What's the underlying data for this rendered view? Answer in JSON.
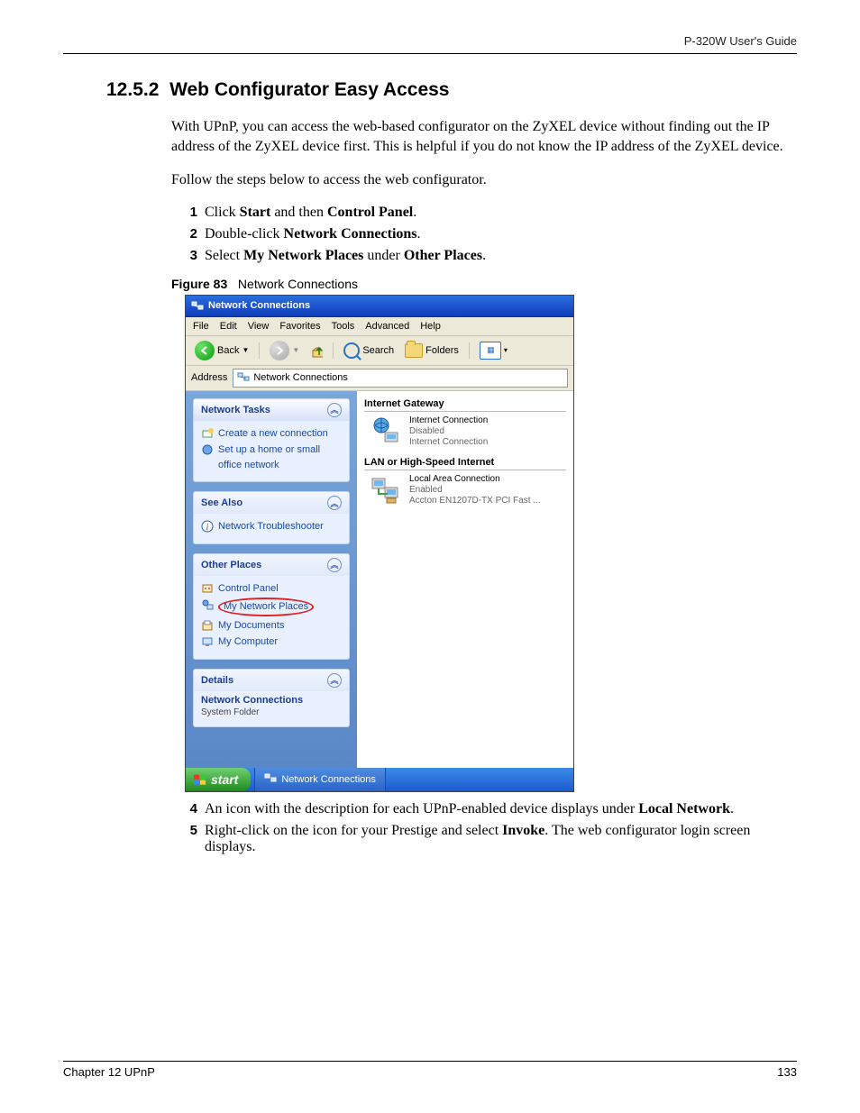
{
  "header": {
    "guide_title": "P-320W User's Guide"
  },
  "section": {
    "number": "12.5.2",
    "title": "Web Configurator Easy Access",
    "para1": "With UPnP, you can access the web-based configurator on the ZyXEL device without finding out the IP address of the ZyXEL device first. This is helpful if you do not know the IP address of the ZyXEL device.",
    "para2": "Follow the steps below to access the web configurator."
  },
  "steps_top": [
    {
      "n": "1",
      "pre": "Click ",
      "b1": "Start",
      "mid": " and then ",
      "b2": "Control Panel",
      "post": "."
    },
    {
      "n": "2",
      "pre": "Double-click ",
      "b1": "Network Connections",
      "mid": "",
      "b2": "",
      "post": "."
    },
    {
      "n": "3",
      "pre": "Select ",
      "b1": "My Network Places",
      "mid": " under ",
      "b2": "Other Places",
      "post": "."
    }
  ],
  "figure": {
    "label": "Figure 83",
    "title": "Network Connections"
  },
  "screenshot": {
    "titlebar": "Network Connections",
    "menus": [
      "File",
      "Edit",
      "View",
      "Favorites",
      "Tools",
      "Advanced",
      "Help"
    ],
    "toolbar": {
      "back": "Back",
      "search": "Search",
      "folders": "Folders"
    },
    "address": {
      "label": "Address",
      "value": "Network Connections"
    },
    "panes": {
      "network_tasks": {
        "title": "Network Tasks",
        "links": [
          "Create a new connection",
          "Set up a home or small office network"
        ]
      },
      "see_also": {
        "title": "See Also",
        "links": [
          "Network Troubleshooter"
        ]
      },
      "other_places": {
        "title": "Other Places",
        "links": [
          "Control Panel",
          "My Network Places",
          "My Documents",
          "My Computer"
        ]
      },
      "details": {
        "title": "Details",
        "name": "Network Connections",
        "type": "System Folder"
      }
    },
    "content": {
      "internet_gateway": {
        "heading": "Internet Gateway",
        "item": {
          "name": "Internet Connection",
          "status": "Disabled",
          "device": "Internet Connection"
        }
      },
      "lan": {
        "heading": "LAN or High-Speed Internet",
        "item": {
          "name": "Local Area Connection",
          "status": "Enabled",
          "device": "Accton EN1207D-TX PCI Fast ..."
        }
      }
    },
    "taskbar": {
      "start": "start",
      "task": "Network Connections"
    }
  },
  "steps_bottom": [
    {
      "n": "4",
      "pre": "An icon with the description for each UPnP-enabled device displays under ",
      "b1": "Local Network",
      "mid": "",
      "b2": "",
      "post": "."
    },
    {
      "n": "5",
      "pre": "Right-click on the icon for your Prestige and select ",
      "b1": "Invoke",
      "mid": "",
      "b2": "",
      "post": ". The web configurator login screen displays."
    }
  ],
  "footer": {
    "chapter": "Chapter 12 UPnP",
    "page": "133"
  }
}
